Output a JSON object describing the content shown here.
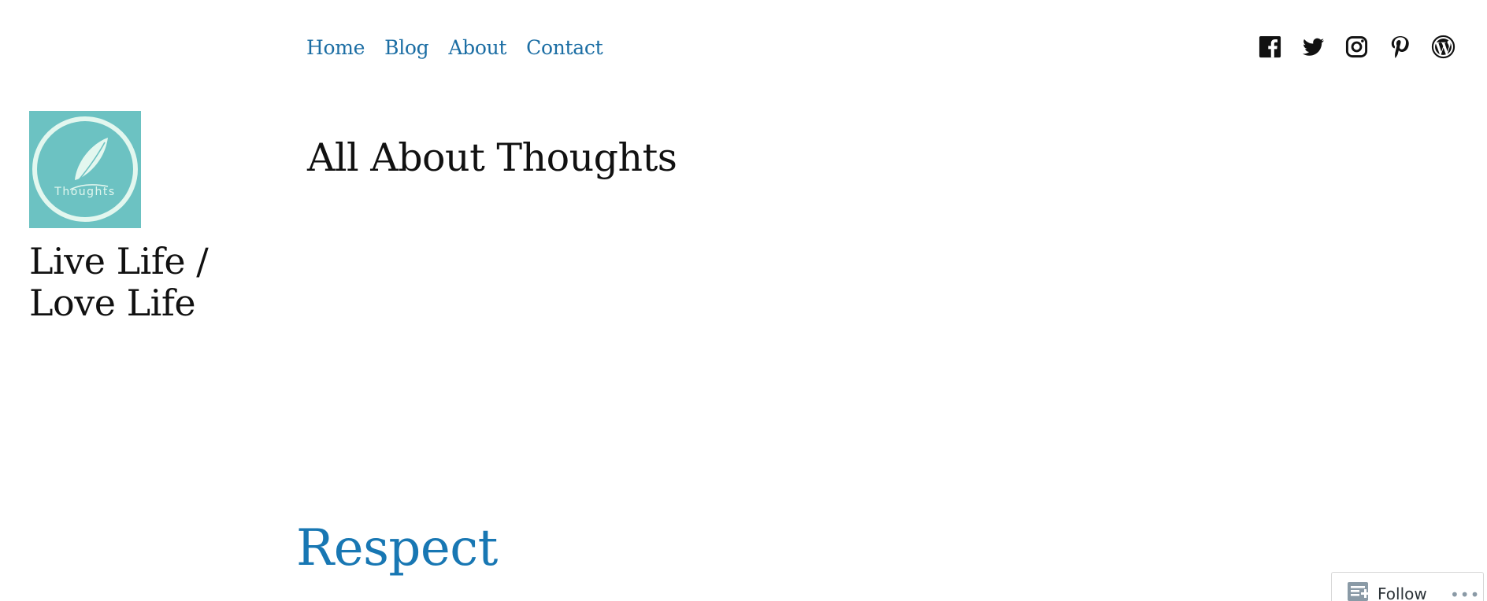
{
  "nav": {
    "items": [
      {
        "label": "Home"
      },
      {
        "label": "Blog"
      },
      {
        "label": "About"
      },
      {
        "label": "Contact"
      }
    ]
  },
  "social": {
    "icons": [
      "facebook-icon",
      "twitter-icon",
      "instagram-icon",
      "pinterest-icon",
      "wordpress-icon"
    ]
  },
  "site": {
    "logo_text": "Thoughts",
    "title_line1": "Live Life /",
    "title_line2": "Love Life"
  },
  "page": {
    "heading": "All About Thoughts"
  },
  "post": {
    "title": "Respect"
  },
  "follow": {
    "label": "Follow",
    "more": "•••"
  },
  "colors": {
    "link": "#1c6ea4",
    "post_title": "#1877b3",
    "logo_bg": "#6cc2c2",
    "logo_fg": "#e3f7ef"
  }
}
